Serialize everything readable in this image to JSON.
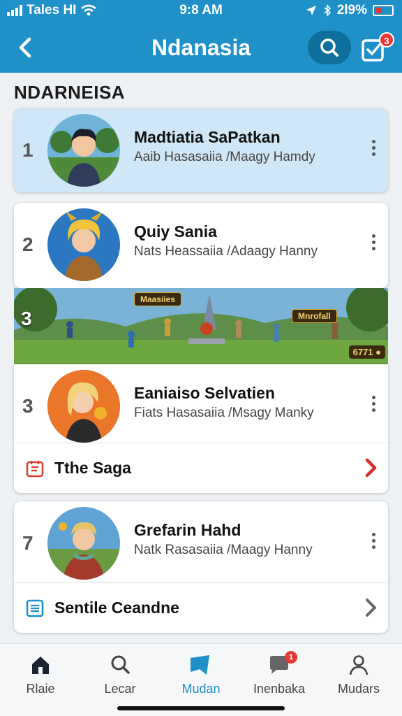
{
  "status": {
    "carrier": "Tales HI",
    "time": "9:8 AM",
    "battery": "2l9%"
  },
  "header": {
    "title": "Ndanasia",
    "task_badge": "3"
  },
  "section_title": "NDARNEISA",
  "entries": [
    {
      "rank": "1",
      "name": "Madtiatia SaPatkan",
      "sub": "Aaib Hasasaiia /Maagy Hamdy"
    },
    {
      "rank": "2",
      "name": "Quiy Sania",
      "sub": "Nats Heassaiia /Adaagy Hanny"
    },
    {
      "rank": "3",
      "name": "Eaniaiso Selvatien",
      "sub": "Fiats Hasasaiia /Msagy Manky",
      "footer_label": "Tthe Saga"
    },
    {
      "rank": "7",
      "name": "Grefarin Hahd",
      "sub": "Natk Rasasaiia /Maagy Hanny",
      "footer_label": "Sentile Ceandne"
    }
  ],
  "banner": {
    "rank": "3",
    "tag_left": "Maasiies",
    "tag_right": "Mnrofall",
    "coins": "6771"
  },
  "nav": [
    {
      "label": "Rlaie",
      "icon": "home-icon"
    },
    {
      "label": "Lecar",
      "icon": "search-icon"
    },
    {
      "label": "Mudan",
      "icon": "flag-icon"
    },
    {
      "label": "Inenbaka",
      "icon": "chat-icon",
      "badge": "1"
    },
    {
      "label": "Mudars",
      "icon": "person-icon"
    }
  ],
  "colors": {
    "primary": "#1f90c8",
    "accent_red": "#e53935",
    "highlight": "#cfe7f6"
  }
}
